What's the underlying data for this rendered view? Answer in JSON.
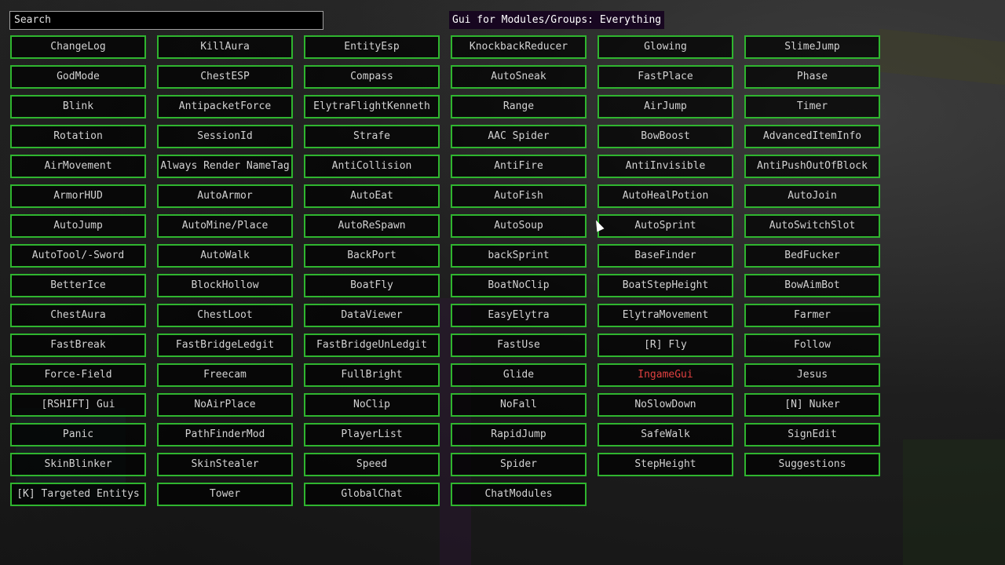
{
  "search": {
    "value": "Search",
    "placeholder": "Search"
  },
  "title": "Gui for Modules/Groups: Everything",
  "colors": {
    "border": "#2fb52f",
    "text": "#d2d2d2",
    "active_text": "#e04040"
  },
  "modules": [
    {
      "label": "ChangeLog"
    },
    {
      "label": "KillAura"
    },
    {
      "label": "EntityEsp"
    },
    {
      "label": "KnockbackReducer"
    },
    {
      "label": "Glowing"
    },
    {
      "label": "SlimeJump"
    },
    {
      "label": "GodMode"
    },
    {
      "label": "ChestESP"
    },
    {
      "label": "Compass"
    },
    {
      "label": "AutoSneak"
    },
    {
      "label": "FastPlace"
    },
    {
      "label": "Phase"
    },
    {
      "label": "Blink"
    },
    {
      "label": "AntipacketForce"
    },
    {
      "label": "ElytraFlightKenneth"
    },
    {
      "label": "Range"
    },
    {
      "label": "AirJump"
    },
    {
      "label": "Timer"
    },
    {
      "label": "Rotation"
    },
    {
      "label": "SessionId"
    },
    {
      "label": "Strafe"
    },
    {
      "label": "AAC Spider"
    },
    {
      "label": "BowBoost"
    },
    {
      "label": "AdvancedItemInfo"
    },
    {
      "label": "AirMovement"
    },
    {
      "label": "Always Render NameTag"
    },
    {
      "label": "AntiCollision"
    },
    {
      "label": "AntiFire"
    },
    {
      "label": "AntiInvisible"
    },
    {
      "label": "AntiPushOutOfBlock"
    },
    {
      "label": "ArmorHUD"
    },
    {
      "label": "AutoArmor"
    },
    {
      "label": "AutoEat"
    },
    {
      "label": "AutoFish"
    },
    {
      "label": "AutoHealPotion"
    },
    {
      "label": "AutoJoin"
    },
    {
      "label": "AutoJump"
    },
    {
      "label": "AutoMine/Place"
    },
    {
      "label": "AutoReSpawn"
    },
    {
      "label": "AutoSoup"
    },
    {
      "label": "AutoSprint"
    },
    {
      "label": "AutoSwitchSlot"
    },
    {
      "label": "AutoTool/-Sword"
    },
    {
      "label": "AutoWalk"
    },
    {
      "label": "BackPort"
    },
    {
      "label": "backSprint"
    },
    {
      "label": "BaseFinder"
    },
    {
      "label": "BedFucker"
    },
    {
      "label": "BetterIce"
    },
    {
      "label": "BlockHollow"
    },
    {
      "label": "BoatFly"
    },
    {
      "label": "BoatNoClip"
    },
    {
      "label": "BoatStepHeight"
    },
    {
      "label": "BowAimBot"
    },
    {
      "label": "ChestAura"
    },
    {
      "label": "ChestLoot"
    },
    {
      "label": "DataViewer"
    },
    {
      "label": "EasyElytra"
    },
    {
      "label": "ElytraMovement"
    },
    {
      "label": "Farmer"
    },
    {
      "label": "FastBreak"
    },
    {
      "label": "FastBridgeLedgit"
    },
    {
      "label": "FastBridgeUnLedgit"
    },
    {
      "label": "FastUse"
    },
    {
      "label": "[R] Fly"
    },
    {
      "label": "Follow"
    },
    {
      "label": "Force-Field"
    },
    {
      "label": "Freecam"
    },
    {
      "label": "FullBright"
    },
    {
      "label": "Glide"
    },
    {
      "label": "IngameGui",
      "active": true
    },
    {
      "label": "Jesus"
    },
    {
      "label": "[RSHIFT] Gui"
    },
    {
      "label": "NoAirPlace"
    },
    {
      "label": "NoClip"
    },
    {
      "label": "NoFall"
    },
    {
      "label": "NoSlowDown"
    },
    {
      "label": "[N] Nuker"
    },
    {
      "label": "Panic"
    },
    {
      "label": "PathFinderMod"
    },
    {
      "label": "PlayerList"
    },
    {
      "label": "RapidJump"
    },
    {
      "label": "SafeWalk"
    },
    {
      "label": "SignEdit"
    },
    {
      "label": "SkinBlinker"
    },
    {
      "label": "SkinStealer"
    },
    {
      "label": "Speed"
    },
    {
      "label": "Spider"
    },
    {
      "label": "StepHeight"
    },
    {
      "label": "Suggestions"
    },
    {
      "label": "[K] Targeted Entitys"
    },
    {
      "label": "Tower"
    },
    {
      "label": "GlobalChat"
    },
    {
      "label": "ChatModules"
    }
  ]
}
